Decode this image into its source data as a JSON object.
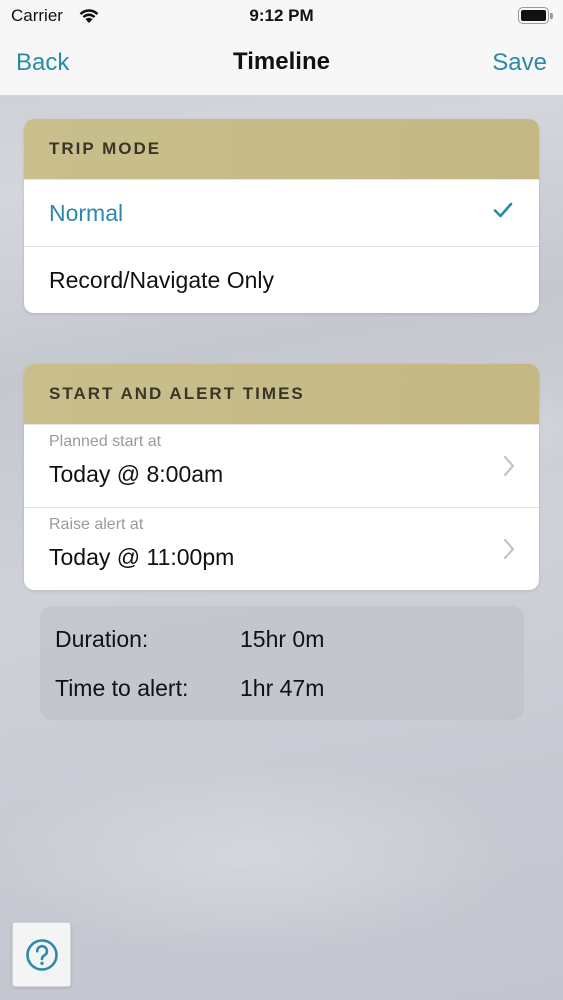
{
  "status_bar": {
    "carrier": "Carrier",
    "time": "9:12 PM"
  },
  "nav": {
    "back_label": "Back",
    "title": "Timeline",
    "save_label": "Save"
  },
  "trip_mode": {
    "header": "TRIP MODE",
    "options": [
      {
        "label": "Normal",
        "selected": true
      },
      {
        "label": "Record/Navigate Only",
        "selected": false
      }
    ]
  },
  "start_alert": {
    "header": "START AND ALERT TIMES",
    "rows": [
      {
        "label": "Planned start at",
        "value": "Today @ 8:00am"
      },
      {
        "label": "Raise alert at",
        "value": "Today @ 11:00pm"
      }
    ]
  },
  "summary": {
    "duration_label": "Duration:",
    "duration_value": "15hr 0m",
    "alert_label": "Time to alert:",
    "alert_value": "1hr 47m"
  },
  "colors": {
    "accent": "#2a8aa8",
    "header_gold": "#c9bf8c"
  },
  "icons": {
    "help": "help-circle-icon",
    "check": "checkmark-icon",
    "chevron": "chevron-right-icon"
  }
}
